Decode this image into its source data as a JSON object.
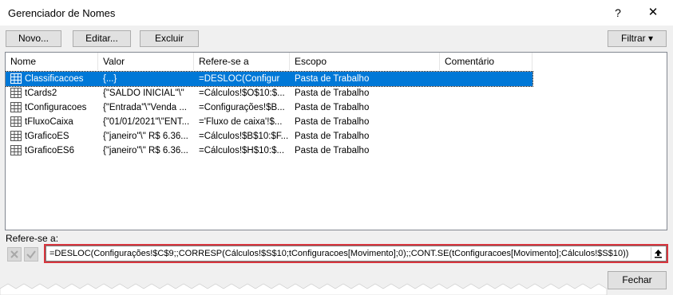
{
  "window": {
    "title": "Gerenciador de Nomes",
    "help": "?",
    "close": "✕"
  },
  "toolbar": {
    "novo": "Novo...",
    "editar": "Editar...",
    "excluir": "Excluir",
    "filtrar": "Filtrar ▾"
  },
  "columns": [
    "Nome",
    "Valor",
    "Refere-se a",
    "Escopo",
    "Comentário"
  ],
  "rows": [
    {
      "name": "Classificacoes",
      "value": "{...}",
      "refers": "=DESLOC(Configur",
      "scope": "Pasta de Trabalho",
      "comment": ""
    },
    {
      "name": "tCards2",
      "value": "{\"SALDO INICIAL\"\\\"",
      "refers": "=Cálculos!$O$10:$...",
      "scope": "Pasta de Trabalho",
      "comment": ""
    },
    {
      "name": "tConfiguracoes",
      "value": "{\"Entrada\"\\\"Venda ...",
      "refers": "=Configurações!$B...",
      "scope": "Pasta de Trabalho",
      "comment": ""
    },
    {
      "name": "tFluxoCaixa",
      "value": "{\"01/01/2021\"\\\"ENT...",
      "refers": "='Fluxo de caixa'!$...",
      "scope": "Pasta de Trabalho",
      "comment": ""
    },
    {
      "name": "tGraficoES",
      "value": "{\"janeiro\"\\\" R$ 6.36...",
      "refers": "=Cálculos!$B$10:$F...",
      "scope": "Pasta de Trabalho",
      "comment": ""
    },
    {
      "name": "tGraficoES6",
      "value": "{\"janeiro\"\\\" R$ 6.36...",
      "refers": "=Cálculos!$H$10:$...",
      "scope": "Pasta de Trabalho",
      "comment": ""
    }
  ],
  "selected_index": 0,
  "refers_label": "Refere-se a:",
  "formula": "=DESLOC(Configurações!$C$9;;CORRESP(Cálculos!$S$10;tConfiguracoes[Movimento];0);;CONT.SE(tConfiguracoes[Movimento];Cálculos!$S$10))",
  "footer": {
    "fechar": "Fechar"
  },
  "colors": {
    "selection": "#0078d7",
    "highlight_border": "#d9363e"
  }
}
